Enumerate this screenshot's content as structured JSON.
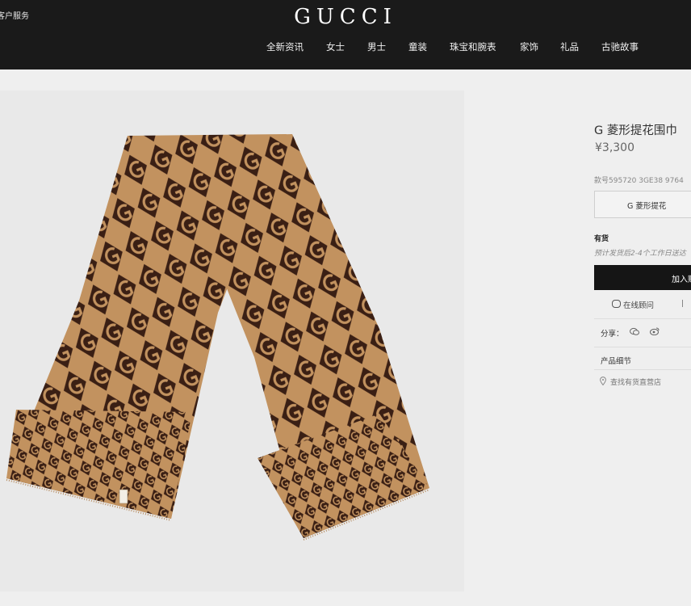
{
  "header": {
    "customer_service": "客户服务",
    "logo": "GUCCI",
    "nav": [
      "全新资讯",
      "女士",
      "男士",
      "童装",
      "珠宝和腕表",
      "家饰",
      "礼品",
      "古驰故事"
    ]
  },
  "product": {
    "title": "G 菱形提花围巾",
    "price": "¥3,300",
    "sku": "款号595720 3GE38 9764",
    "variant": "G 菱形提花",
    "stock": "有货",
    "shipping": "预计发货后2-4个工作日送达",
    "add_to_cart": "加入购物袋",
    "online_advisor": "在线顾问",
    "share_label": "分享：",
    "details_label": "产品细节",
    "store_finder": "查找有货直营店"
  },
  "colors": {
    "header_bg": "#1a1a1a",
    "page_bg": "#efefef",
    "scarf_dark": "#3a1f14",
    "scarf_light": "#c2925f"
  },
  "icons": [
    "chat-icon",
    "wechat-icon",
    "weibo-icon",
    "location-pin-icon"
  ]
}
